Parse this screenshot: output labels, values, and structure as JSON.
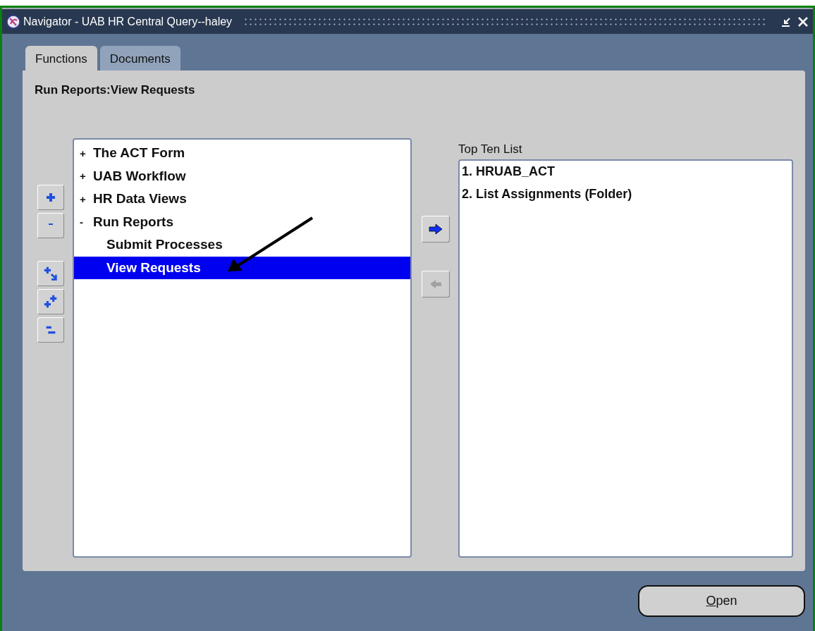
{
  "window": {
    "title": "Navigator - UAB HR Central Query--haley"
  },
  "tabs": [
    {
      "label": "Functions",
      "selected": true
    },
    {
      "label": "Documents",
      "selected": false
    }
  ],
  "heading": "Run Reports:View Requests",
  "tree": [
    {
      "marker": "+",
      "label": "The ACT Form",
      "selected": false
    },
    {
      "marker": "+",
      "label": "UAB Workflow",
      "selected": false
    },
    {
      "marker": "+",
      "label": "HR Data Views",
      "selected": false
    },
    {
      "marker": "-",
      "label": "Run Reports",
      "selected": false,
      "children": [
        {
          "label": "Submit Processes",
          "selected": false
        },
        {
          "label": "View Requests",
          "selected": true
        }
      ]
    }
  ],
  "add_button": {
    "disabled": false
  },
  "remove_button": {
    "disabled": true
  },
  "top_ten": {
    "label": "Top Ten List",
    "items": [
      "1. HRUAB_ACT",
      "2. List Assignments (Folder)"
    ]
  },
  "open_button": "Open"
}
